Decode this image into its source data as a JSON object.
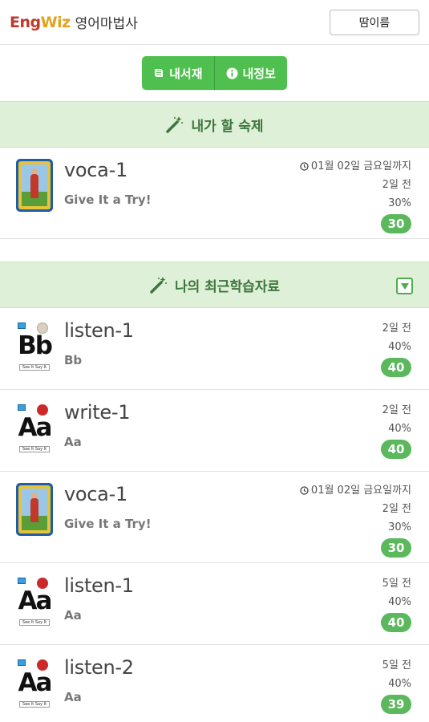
{
  "header": {
    "logo_eng": "Eng",
    "logo_wiz": "Wiz",
    "app_name": "영어마법사",
    "user_button": "땀이름"
  },
  "nav": {
    "my_books": "내서재",
    "my_info": "내정보",
    "my_books_icon": "book-icon",
    "my_info_icon": "info-circle-icon"
  },
  "homework": {
    "title": "내가 할 숙제",
    "icon": "magic-wand-icon",
    "items": [
      {
        "title": "voca-1",
        "subtitle": "Give It a Try!",
        "due": "01월 02일 금요일까지",
        "ago": "2일 전",
        "percent": "30%",
        "score": "30",
        "thumb": "book-cover"
      }
    ]
  },
  "recent": {
    "title": "나의 최근학습자료",
    "icon": "magic-wand-icon",
    "toggle_icon": "caret-down-square-icon",
    "items": [
      {
        "title": "listen-1",
        "subtitle": "Bb",
        "ago": "2일 전",
        "percent": "40%",
        "score": "40",
        "thumb_letter": "Bb",
        "fruit_color": "#d9d0c0"
      },
      {
        "title": "write-1",
        "subtitle": "Aa",
        "ago": "2일 전",
        "percent": "40%",
        "score": "40",
        "thumb_letter": "Aa",
        "fruit_color": "#cc2a2a"
      },
      {
        "title": "voca-1",
        "subtitle": "Give It a Try!",
        "due": "01월 02일 금요일까지",
        "ago": "2일 전",
        "percent": "30%",
        "score": "30",
        "thumb": "book-cover"
      },
      {
        "title": "listen-1",
        "subtitle": "Aa",
        "ago": "5일 전",
        "percent": "40%",
        "score": "40",
        "thumb_letter": "Aa",
        "fruit_color": "#cc2a2a"
      },
      {
        "title": "listen-2",
        "subtitle": "Aa",
        "ago": "5일 전",
        "percent": "40%",
        "score": "39",
        "thumb_letter": "Aa",
        "fruit_color": "#cc2a2a"
      }
    ]
  },
  "colors": {
    "accent_green": "#5cb85c",
    "section_bg": "#dff0d8",
    "section_text": "#3c763d",
    "logo_red": "#c0392b",
    "logo_orange": "#e5a21b"
  }
}
